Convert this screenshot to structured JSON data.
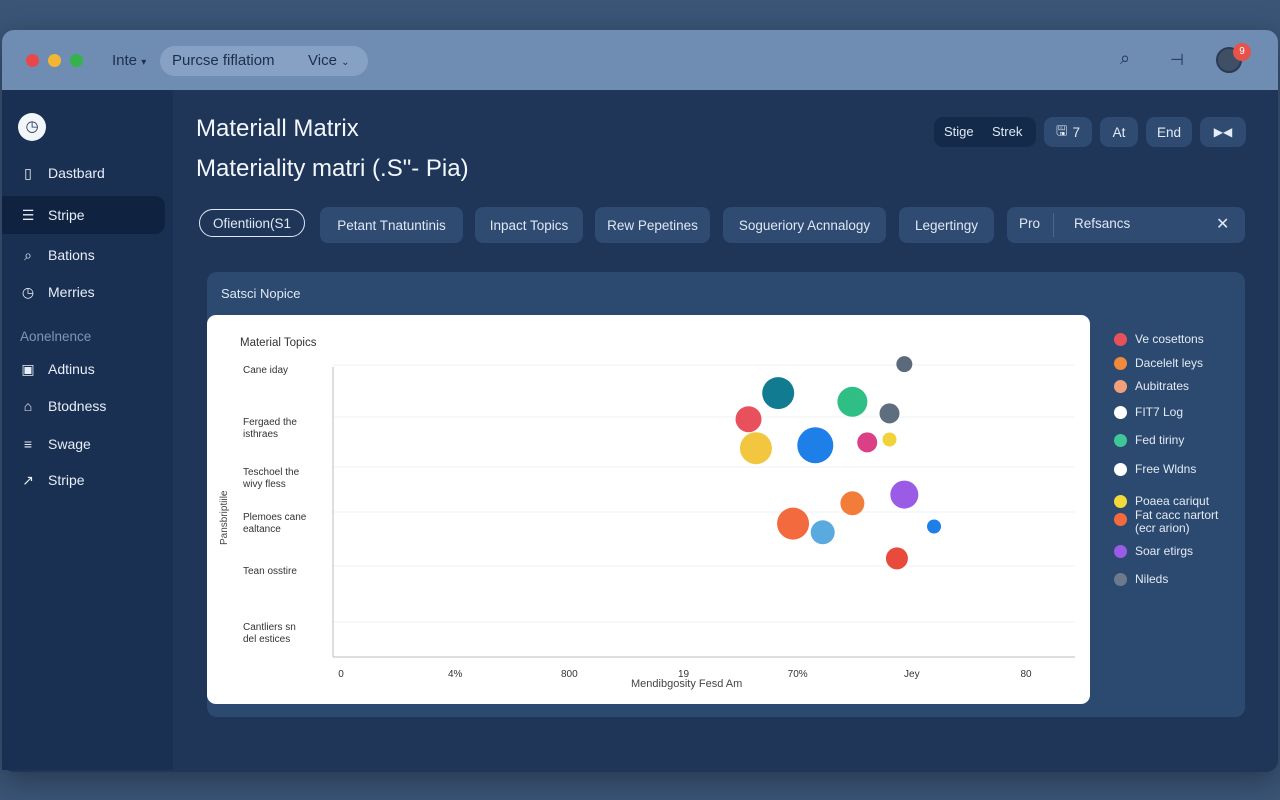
{
  "titlebar": {
    "menu_label": "Inte",
    "address": "Purcse fiflatiom",
    "view_label": "Vice",
    "avatar_badge": "9"
  },
  "sidebar": {
    "items": [
      {
        "icon": "document-icon",
        "label": "Dastbard"
      },
      {
        "icon": "menu-icon",
        "label": "Stripe"
      },
      {
        "icon": "search-icon",
        "label": "Bations"
      },
      {
        "icon": "clock-icon",
        "label": "Merries"
      }
    ],
    "section_label": "Aonelnence",
    "section_items": [
      {
        "icon": "id-card-icon",
        "label": "Adtinus"
      },
      {
        "icon": "home-icon",
        "label": "Btodness"
      },
      {
        "icon": "list-icon",
        "label": "Swage"
      },
      {
        "icon": "chart-icon",
        "label": "Stripe"
      }
    ]
  },
  "header": {
    "title": "Materiall Matrix",
    "subtitle": "Materiality matri (.S\"- Pia)"
  },
  "toolbar": {
    "seg_left": "Stige",
    "seg_right": "Strek",
    "save_count": "7",
    "btn_at": "At",
    "btn_end": "End"
  },
  "tabs": [
    {
      "label": "Ofientiion(S1"
    },
    {
      "label": "Petant Tnatuntinis"
    },
    {
      "label": "Inpact Topics"
    },
    {
      "label": "Rew Pepetines"
    },
    {
      "label": "Sogueriory Acnnalogy"
    },
    {
      "label": "Legertingy"
    },
    {
      "label": "Pro"
    },
    {
      "label": "Refsancs"
    }
  ],
  "card": {
    "title": "Satsci Nopice"
  },
  "chart_data": {
    "type": "scatter",
    "title": "Material Topics",
    "xlabel": "Mendibgosity Fesd Am",
    "ylabel": "Pansbriptiile",
    "x_ticks": [
      "0",
      "4%",
      "800",
      "19",
      "70%",
      "Jey",
      "80"
    ],
    "y_ticks": [
      "Cane iday",
      "Fergaed the isthraes",
      "Teschoel the wivy fless",
      "Plemoes cane ealtance",
      "Tean osstire",
      "Cantliers sn del estices"
    ],
    "points": [
      {
        "x": 0.56,
        "y": 0.82,
        "size": 13,
        "color": "#e8505b"
      },
      {
        "x": 0.57,
        "y": 0.72,
        "size": 16,
        "color": "#f3c640"
      },
      {
        "x": 0.6,
        "y": 0.91,
        "size": 16,
        "color": "#117c91"
      },
      {
        "x": 0.62,
        "y": 0.46,
        "size": 16,
        "color": "#f26a3d"
      },
      {
        "x": 0.65,
        "y": 0.73,
        "size": 18,
        "color": "#1e7fe8"
      },
      {
        "x": 0.66,
        "y": 0.43,
        "size": 12,
        "color": "#5aa9df"
      },
      {
        "x": 0.7,
        "y": 0.88,
        "size": 15,
        "color": "#2fbf85"
      },
      {
        "x": 0.7,
        "y": 0.53,
        "size": 12,
        "color": "#f27c3a"
      },
      {
        "x": 0.72,
        "y": 0.74,
        "size": 10,
        "color": "#db3f85"
      },
      {
        "x": 0.75,
        "y": 0.75,
        "size": 7,
        "color": "#f2d23a"
      },
      {
        "x": 0.75,
        "y": 0.84,
        "size": 10,
        "color": "#5e6e7f"
      },
      {
        "x": 0.76,
        "y": 0.34,
        "size": 11,
        "color": "#e84a3b"
      },
      {
        "x": 0.77,
        "y": 0.56,
        "size": 14,
        "color": "#9a5ce6"
      },
      {
        "x": 0.77,
        "y": 1.01,
        "size": 8,
        "color": "#5b6a7a"
      },
      {
        "x": 0.81,
        "y": 0.45,
        "size": 7,
        "color": "#1e7fe8"
      }
    ],
    "legend": [
      {
        "label": "Ve cosettons",
        "color": "#e8505b"
      },
      {
        "label": "Dacelelt leys",
        "color": "#f08a3d"
      },
      {
        "label": "Aubitrates",
        "color": "#f2a07a"
      },
      {
        "label": "FIT7 Log",
        "color": "#ffffff"
      },
      {
        "label": "Fed tiriny",
        "color": "#3fc79a"
      },
      {
        "label": "Free Wldns",
        "color": "#ffffff"
      },
      {
        "label": "Poaea cariqut",
        "color": "#f3d93a"
      },
      {
        "label": "Fat cacc nartort (ecr arion)",
        "color": "#f26a3d"
      },
      {
        "label": "Soar etirgs",
        "color": "#9a5ce6"
      },
      {
        "label": "Nileds",
        "color": "#6c7b8c"
      }
    ]
  }
}
